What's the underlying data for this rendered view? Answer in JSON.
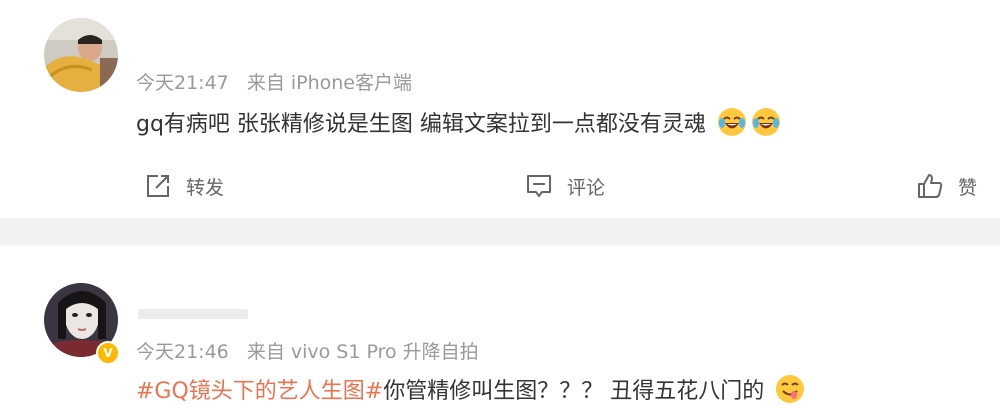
{
  "posts": [
    {
      "time": "今天21:47",
      "source": "来自 iPhone客户端",
      "text": "gq有病吧 张张精修说是生图 编辑文案拉到一点都没有灵魂",
      "emojis": [
        "laugh-cry",
        "laugh-cry"
      ]
    },
    {
      "time": "今天21:46",
      "source": "来自 vivo S1 Pro 升降自拍",
      "topic": "#GQ镜头下的艺人生图#",
      "text": "你管精修叫生图？？？ 丑得五花八门的",
      "emojis": [
        "smirk"
      ],
      "verified": "V"
    }
  ],
  "actions": {
    "repost": "转发",
    "comment": "评论",
    "like": "赞"
  },
  "colors": {
    "topic": "#eb7350",
    "meta": "#9a9a9a",
    "text": "#333333",
    "divider": "#f2f2f2",
    "badge": "#ffb800"
  }
}
